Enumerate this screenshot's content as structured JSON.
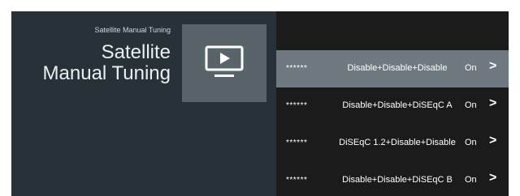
{
  "header": {
    "breadcrumb": "Satellite Manual Tuning",
    "title_line1": "Satellite",
    "title_line2": "Manual Tuning"
  },
  "icon": {
    "name": "tv-play-icon"
  },
  "list": {
    "items": [
      {
        "stars": "******",
        "config": "Disable+Disable+Disable",
        "status": "On",
        "chevron": ">",
        "selected": true
      },
      {
        "stars": "******",
        "config": "Disable+Disable+DiSEqC A",
        "status": "On",
        "chevron": ">",
        "selected": false
      },
      {
        "stars": "******",
        "config": "DiSEqC 1.2+Disable+Disable",
        "status": "On",
        "chevron": ">",
        "selected": false
      },
      {
        "stars": "******",
        "config": "Disable+Disable+DiSEqC B",
        "status": "On",
        "chevron": ">",
        "selected": false
      }
    ]
  },
  "colors": {
    "background": "#263238",
    "tile": "#58636a",
    "list_bg": "#1b1b1b",
    "selected_row": "#6f7a80",
    "text": "#ffffff"
  }
}
